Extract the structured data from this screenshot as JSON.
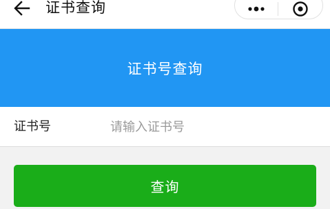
{
  "navbar": {
    "title": "证书查询",
    "back_icon": "arrow-left-icon",
    "more_icon": "more-dots-icon",
    "close_icon": "target-circle-icon"
  },
  "banner": {
    "title": "证书号查询",
    "color": "#2196f3"
  },
  "form": {
    "cert_label": "证书号",
    "cert_placeholder": "请输入证书号",
    "cert_value": ""
  },
  "actions": {
    "query_label": "查询",
    "query_color": "#1aad19"
  }
}
